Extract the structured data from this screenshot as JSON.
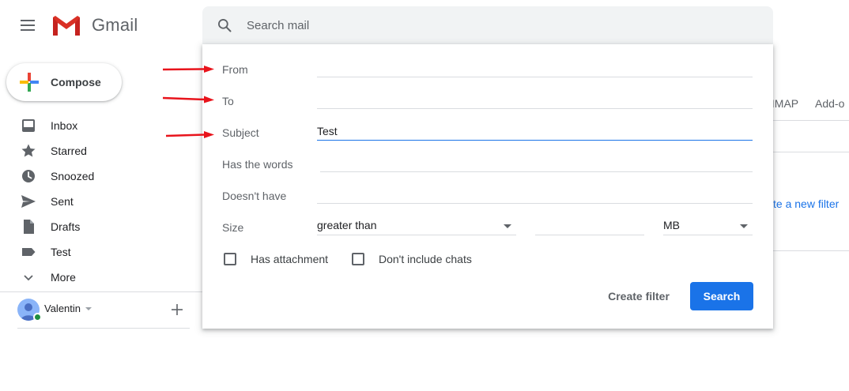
{
  "app": {
    "name": "Gmail",
    "brand_red": "#d93025",
    "accent": "#1a73e8"
  },
  "search": {
    "placeholder": "Search mail"
  },
  "compose": {
    "label": "Compose"
  },
  "sidebar": {
    "items": [
      {
        "label": "Inbox",
        "icon": "inbox-icon"
      },
      {
        "label": "Starred",
        "icon": "star-icon"
      },
      {
        "label": "Snoozed",
        "icon": "clock-icon"
      },
      {
        "label": "Sent",
        "icon": "send-icon"
      },
      {
        "label": "Drafts",
        "icon": "draft-icon"
      },
      {
        "label": "Test",
        "icon": "label-icon"
      },
      {
        "label": "More",
        "icon": "chevron-down-icon"
      }
    ],
    "user": {
      "name": "Valentin",
      "status_color": "#1e8e3e"
    }
  },
  "background": {
    "tabs": [
      "/IMAP",
      "Add-o"
    ],
    "link": "te a new filter"
  },
  "filter": {
    "fields": [
      {
        "label": "From",
        "value": ""
      },
      {
        "label": "To",
        "value": ""
      },
      {
        "label": "Subject",
        "value": "Test"
      },
      {
        "label": "Has the words",
        "value": ""
      },
      {
        "label": "Doesn't have",
        "value": ""
      }
    ],
    "size": {
      "label": "Size",
      "operator": "greater than",
      "value": "",
      "unit": "MB"
    },
    "checkboxes": [
      {
        "label": "Has attachment",
        "checked": false
      },
      {
        "label": "Don't include chats",
        "checked": false
      }
    ],
    "create_filter_label": "Create filter",
    "search_label": "Search"
  },
  "annotations": {
    "arrow_color": "#e8141c",
    "arrow_targets": [
      "From",
      "To",
      "Subject"
    ]
  }
}
